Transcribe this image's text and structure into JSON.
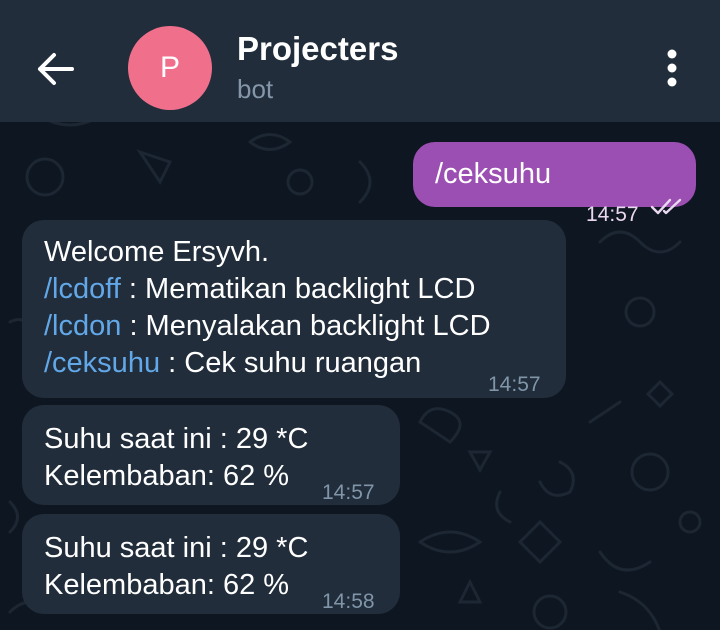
{
  "header": {
    "back_icon": "arrow-left-icon",
    "avatar_letter": "P",
    "avatar_color": "#f0708c",
    "title": "Projecters",
    "subtitle": "bot",
    "menu_icon": "more-vertical-icon"
  },
  "messages": [
    {
      "direction": "outgoing",
      "text": "/ceksuhu",
      "time": "14:57",
      "status_icon": "double-check-icon"
    },
    {
      "direction": "incoming",
      "line1": "Welcome  Ersyvh.",
      "line2_cmd": "/lcdoff",
      "line2_text": " : Mematikan backlight LCD",
      "line3_cmd": "/lcdon",
      "line3_text": " : Menyalakan backlight LCD",
      "line4_cmd": "/ceksuhu",
      "line4_text": " : Cek suhu ruangan",
      "time": "14:57"
    },
    {
      "direction": "incoming",
      "line1": "Suhu saat ini : 29 *C",
      "line2": "Kelembaban: 62 %",
      "time": "14:57"
    },
    {
      "direction": "incoming",
      "line1": "Suhu saat ini : 29 *C",
      "line2": "Kelembaban: 62 %",
      "time": "14:58"
    }
  ],
  "colors": {
    "header_bg": "#212d3b",
    "chat_bg": "#0e1621",
    "incoming_bubble": "#212d3b",
    "outgoing_bubble": "#9b4fb2",
    "link": "#62a8e8"
  }
}
